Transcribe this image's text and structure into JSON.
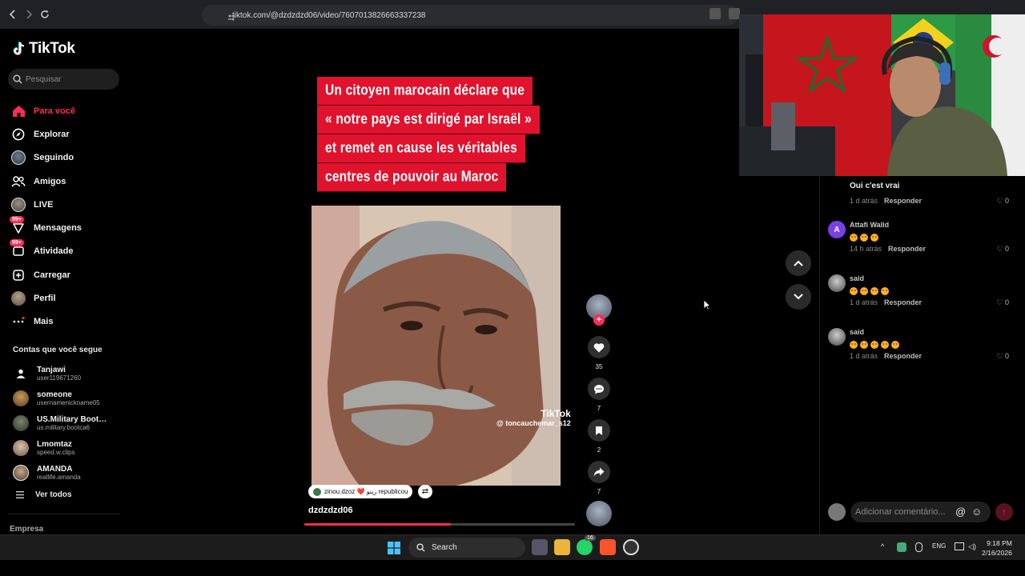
{
  "browser": {
    "url": "tiktok.com/@dzdzdzd06/video/7607013826663337238"
  },
  "sidebar": {
    "logo": "TikTok",
    "search_placeholder": "Pesquisar",
    "nav": [
      {
        "label": "Para você",
        "icon": "home-icon",
        "active": true
      },
      {
        "label": "Explorar",
        "icon": "compass-icon"
      },
      {
        "label": "Seguindo",
        "icon": "following-avatar-icon"
      },
      {
        "label": "Amigos",
        "icon": "friends-icon"
      },
      {
        "label": "LIVE",
        "icon": "live-icon"
      },
      {
        "label": "Mensagens",
        "icon": "messages-icon",
        "badge": "99+"
      },
      {
        "label": "Atividade",
        "icon": "activity-icon",
        "badge": "99+"
      },
      {
        "label": "Carregar",
        "icon": "upload-icon"
      },
      {
        "label": "Perfil",
        "icon": "profile-avatar-icon"
      },
      {
        "label": "Mais",
        "icon": "more-icon"
      }
    ],
    "following_title": "Contas que você segue",
    "following": [
      {
        "name": "Tanjawi",
        "user": "user119671260"
      },
      {
        "name": "someone",
        "user": "usernamenickname05"
      },
      {
        "name": "US.Military Bootca...",
        "user": "us.military.bootca6"
      },
      {
        "name": "Lmomtaz",
        "user": "speed.w.clips"
      },
      {
        "name": "AMANDA",
        "user": "reallife.amanda"
      }
    ],
    "see_all": "Ver todos",
    "company": "Empresa"
  },
  "video": {
    "title_lines": [
      "Un citoyen marocain déclare que",
      "« notre pays est dirigé par Israël »",
      "et remet en cause les véritables",
      "centres de pouvoir au Maroc"
    ],
    "watermark_logo": "TikTok",
    "watermark_user": "@ toncauchemar_s12",
    "repost_text": "zinou.dzoz ❤️ زينو republicou",
    "author": "dzdzdzd06",
    "progress": 0.54
  },
  "actions": {
    "likes": "35",
    "comments": "7",
    "saves": "2",
    "shares": "7"
  },
  "comments": [
    {
      "name": "",
      "text": "Oui c'est vrai",
      "time": "1 d atrás",
      "reply": "Responder",
      "likes": "0"
    },
    {
      "name": "Attafi Walid",
      "avatar_letter": "A",
      "text": "",
      "emoji_count": 3,
      "time": "14 h atrás",
      "reply": "Responder",
      "likes": "0"
    },
    {
      "name": "said",
      "text": "",
      "emoji_count": 4,
      "time": "1 d atrás",
      "reply": "Responder",
      "likes": "0"
    },
    {
      "name": "said",
      "text": "",
      "emoji_count": 5,
      "time": "1 d atrás",
      "reply": "Responder",
      "likes": "0"
    }
  ],
  "comment_input": {
    "placeholder": "Adicionar comentário..."
  },
  "taskbar": {
    "search": "Search",
    "lang": "ENG",
    "time": "9:18 PM",
    "date": "2/16/2026",
    "whatsapp_badge": "16"
  },
  "colors": {
    "accent": "#fe2c55",
    "title_bg": "#e0122d"
  }
}
